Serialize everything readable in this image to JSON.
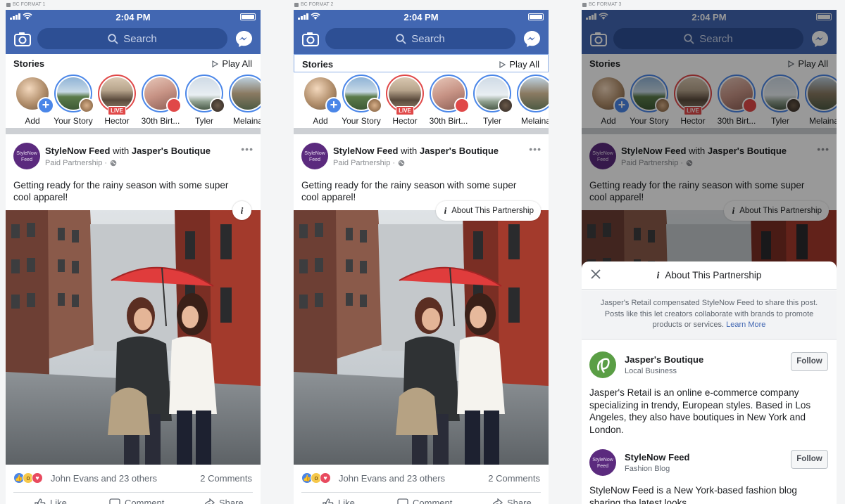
{
  "frames": [
    {
      "label": "BC FORMAT 1"
    },
    {
      "label": "BC FORMAT 2"
    },
    {
      "label": "BC FORMAT 3"
    }
  ],
  "status": {
    "time": "2:04 PM"
  },
  "nav": {
    "search_placeholder": "Search"
  },
  "stories": {
    "title": "Stories",
    "play_all": "Play All",
    "items": [
      {
        "name": "Add"
      },
      {
        "name": "Your Story"
      },
      {
        "name": "Hector",
        "badge": "LIVE"
      },
      {
        "name": "30th Birt..."
      },
      {
        "name": "Tyler"
      },
      {
        "name": "Melaina"
      }
    ]
  },
  "post": {
    "page_name": "StyleNow Feed",
    "with_text": "with",
    "partner_name": "Jasper's Boutique",
    "subtitle": "Paid Partnership ·",
    "avatar_text": "StyleNow Feed",
    "caption": "Getting ready for the rainy season with some super cool apparel!",
    "info_glyph": "i",
    "about_label": "About This Partnership",
    "reactors": "John Evans and 23 others",
    "comments": "2 Comments",
    "like": "Like",
    "comment": "Comment",
    "share": "Share"
  },
  "sheet": {
    "title": "About This Partnership",
    "description": "Jasper's Retail compensated StyleNow Feed to share this post. Posts like this let creators collaborate with brands to promote products or services.",
    "learn_more": "Learn More",
    "brands": [
      {
        "name": "Jasper's Boutique",
        "type": "Local Business",
        "follow": "Follow",
        "about": "Jasper's Retail is an online e-commerce company specializing in trendy, European styles. Based in Los Angeles, they also have boutiques in New York and London."
      },
      {
        "name": "StyleNow Feed",
        "type": "Fashion Blog",
        "follow": "Follow",
        "about": "StyleNow Feed is a New York-based fashion blog sharing the latest looks"
      }
    ]
  },
  "colors": {
    "brand_blue": "#4267b2",
    "live_red": "#e04848",
    "story_ring": "#4a86e8"
  }
}
